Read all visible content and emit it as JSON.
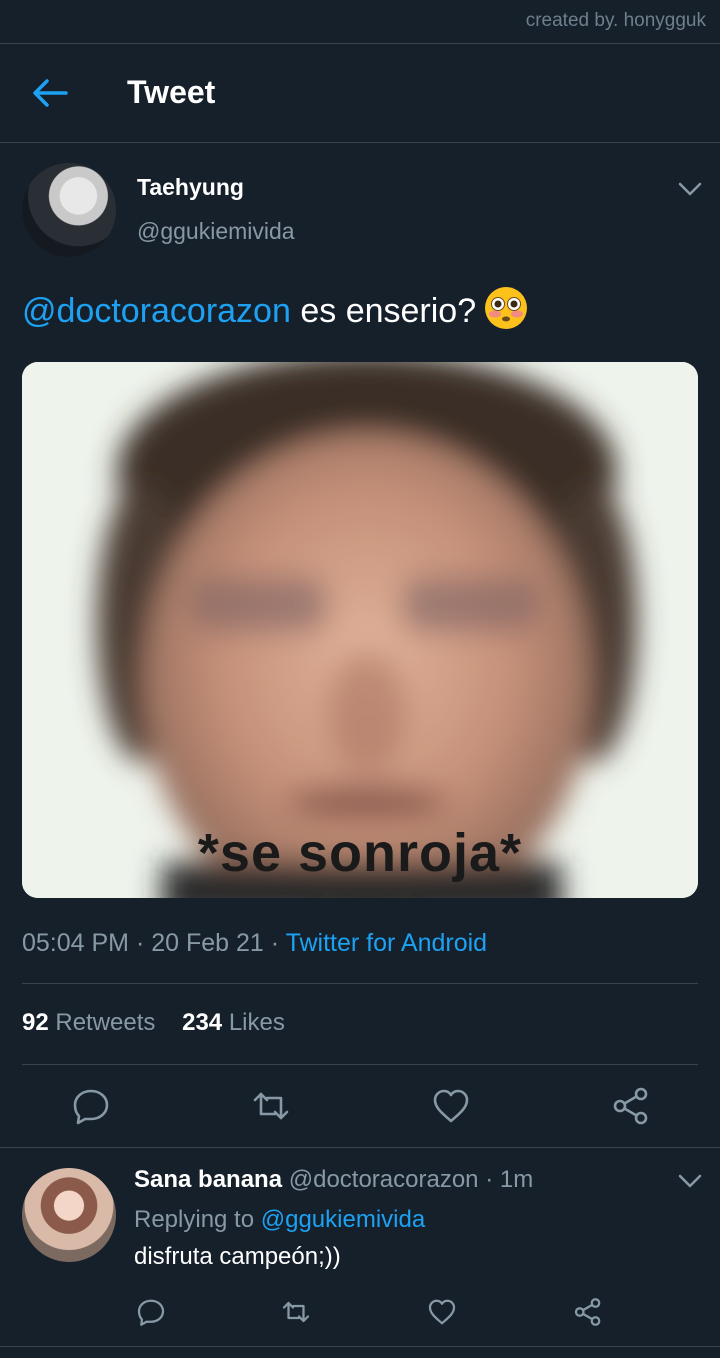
{
  "watermark": "created by. honygguk",
  "header": {
    "title": "Tweet"
  },
  "tweet": {
    "author_name": "Taehyung",
    "author_handle": "@ggukiemivida",
    "mention": "@doctoracorazon",
    "text": " es enserio?",
    "emoji": "flushed-face-emoji",
    "media_caption": "*se sonroja*",
    "time": "05:04 PM",
    "date": "20 Feb 21",
    "separator": " · ",
    "source": "Twitter for Android",
    "retweets_count": "92",
    "retweets_label": "Retweets",
    "likes_count": "234",
    "likes_label": "Likes"
  },
  "reply": {
    "name": "Sana banana",
    "handle": "@doctoracorazon",
    "time": "1m",
    "replying_label": "Replying to ",
    "replying_to": "@ggukiemivida",
    "text": "disfruta campeón;))"
  },
  "colors": {
    "background": "#15202b",
    "accent": "#1da1f2",
    "secondary_text": "#8899a6",
    "divider": "#38444d"
  },
  "icons": [
    "back-arrow-icon",
    "chevron-down-icon",
    "reply-icon",
    "retweet-icon",
    "like-icon",
    "share-icon"
  ]
}
